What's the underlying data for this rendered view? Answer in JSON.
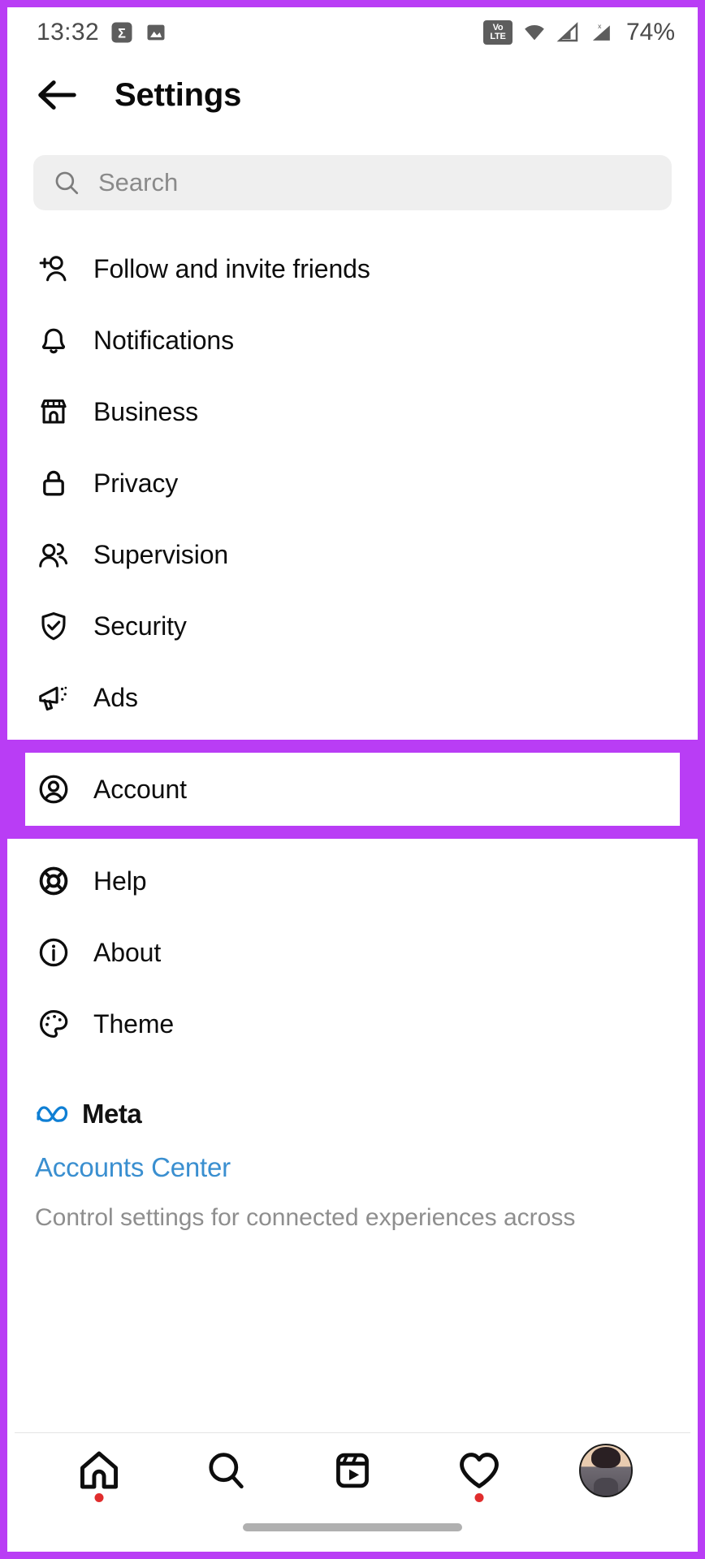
{
  "status_bar": {
    "time": "13:32",
    "battery": "74%",
    "left_icons": [
      {
        "name": "sigma-app-icon",
        "glyph": "Σ"
      },
      {
        "name": "image-gallery-icon",
        "glyph": "▨"
      }
    ],
    "right_icons": [
      {
        "name": "volte-icon",
        "line1": "Vo",
        "line2": "LTE",
        "sim": "1"
      },
      {
        "name": "wifi-icon"
      },
      {
        "name": "signal-sim1-icon"
      },
      {
        "name": "signal-sim2-icon",
        "badge": "x"
      }
    ]
  },
  "header": {
    "back_label": "back",
    "title": "Settings"
  },
  "search": {
    "placeholder": "Search",
    "value": ""
  },
  "menu": {
    "items": [
      {
        "icon": "add-person-icon",
        "label": "Follow and invite friends"
      },
      {
        "icon": "bell-icon",
        "label": "Notifications"
      },
      {
        "icon": "store-icon",
        "label": "Business"
      },
      {
        "icon": "lock-icon",
        "label": "Privacy"
      },
      {
        "icon": "people-icon",
        "label": "Supervision"
      },
      {
        "icon": "shield-check-icon",
        "label": "Security"
      },
      {
        "icon": "megaphone-icon",
        "label": "Ads"
      }
    ],
    "highlighted": {
      "icon": "user-circle-icon",
      "label": "Account"
    },
    "items_after": [
      {
        "icon": "life-ring-icon",
        "label": "Help"
      },
      {
        "icon": "info-circle-icon",
        "label": "About"
      },
      {
        "icon": "palette-icon",
        "label": "Theme"
      }
    ]
  },
  "meta": {
    "brand": "Meta",
    "link": "Accounts Center",
    "description": "Control settings for connected experiences across"
  },
  "bottom_nav": {
    "items": [
      {
        "name": "home-icon",
        "badge": true
      },
      {
        "name": "search-icon",
        "badge": false
      },
      {
        "name": "reels-icon",
        "badge": false
      },
      {
        "name": "heart-icon",
        "badge": true
      },
      {
        "name": "profile-avatar",
        "badge": false
      }
    ]
  },
  "colors": {
    "highlight": "#b93df5",
    "link": "#3a8fd0",
    "badge": "#e02d2d"
  }
}
